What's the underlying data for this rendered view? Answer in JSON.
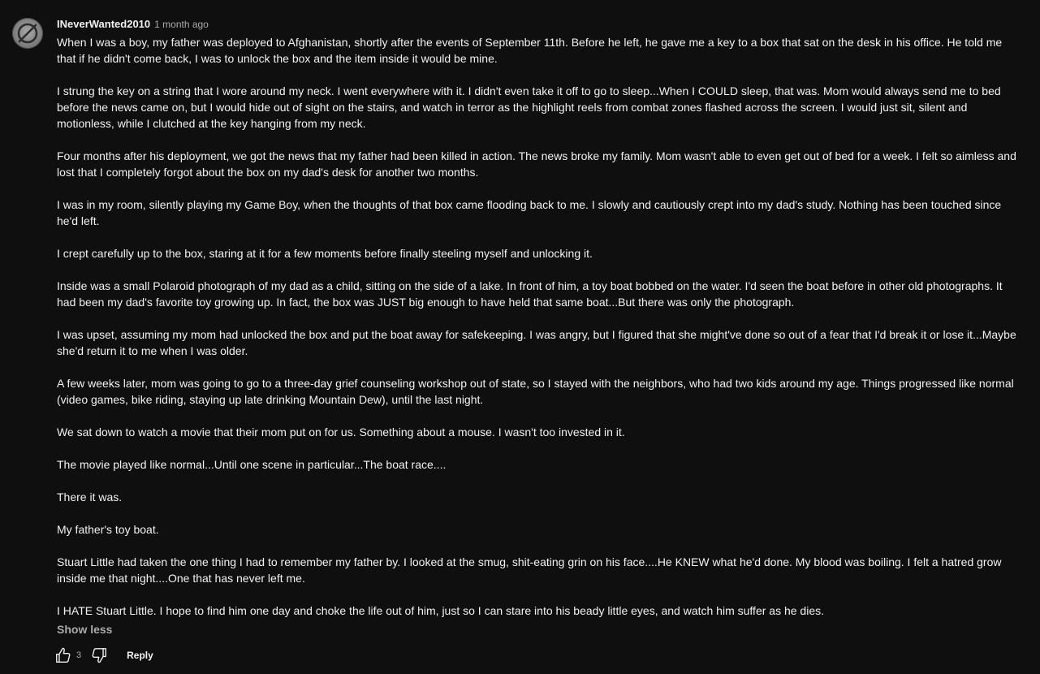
{
  "comment": {
    "author": "INeverWanted2010",
    "timestamp": "1 month ago",
    "paragraphs": [
      "When I was a boy, my father was deployed to Afghanistan, shortly after the events of September 11th. Before he left, he gave me a key to a box that sat on the desk in his office. He told me that if he didn't come back, I was to unlock the box and the item inside it would be mine.",
      "I strung the key on a string that I wore around my neck. I went everywhere with it. I didn't even take it off to go to sleep...When I COULD sleep, that was. Mom would always send me to bed before the news came on, but I would hide out of sight on the stairs, and watch in terror as the highlight reels from combat zones flashed across the screen. I would just sit, silent and motionless, while I clutched at the key hanging from my neck.",
      "Four months after his deployment, we got the news that my father had been killed in action. The news broke my family. Mom wasn't able to even get out of bed for a week. I felt so aimless and lost that I completely forgot about the box on my dad's desk for another two months.",
      "I was in my room, silently playing my Game Boy, when the thoughts of that box came flooding back to me. I slowly and cautiously crept into my dad's study. Nothing has been touched since he'd left.",
      "I crept carefully up to the box, staring at it for a few moments before finally steeling myself and unlocking it.",
      "Inside was a small Polaroid photograph of my dad as a child, sitting on the side of a lake. In front of him, a toy boat bobbed on the water. I'd seen the boat before in other old photographs. It had been my dad's favorite toy growing up. In fact, the box was JUST big enough to have held that same boat...But there was only the photograph.",
      "I was upset, assuming my mom had unlocked the box and put the boat away for safekeeping. I was angry, but I figured that she might've done so out of a fear that I'd break it or lose it...Maybe she'd return it to me when I was older.",
      "A few weeks later, mom was going to go to a three-day grief counseling workshop out of state, so I stayed with the neighbors, who had two kids around my age. Things progressed like normal (video games, bike riding, staying up late drinking Mountain Dew), until the last night.",
      "We sat down to watch a movie that their mom put on for us. Something about a mouse. I wasn't too invested in it.",
      "The movie played like normal...Until one scene in particular...The boat race....",
      "There it was.",
      "My father's toy boat.",
      "Stuart Little had taken the one thing I had to remember my father by. I looked at the smug, shit-eating grin on his face....He KNEW what he'd done. My blood was boiling. I felt a hatred grow inside me that night....One that has never left me.",
      "I HATE Stuart Little. I hope to find him one day and choke the life out of him, just so I can stare into his beady little eyes, and watch him suffer as he dies."
    ],
    "show_less_label": "Show less",
    "like_count": "3",
    "reply_label": "Reply",
    "avatar_icon": "default-avatar-icon",
    "like_icon": "thumbs-up-icon",
    "dislike_icon": "thumbs-down-icon"
  },
  "colors": {
    "background": "#0f0f0f",
    "text_primary": "#f1f1f1",
    "text_secondary": "#aaaaaa"
  }
}
